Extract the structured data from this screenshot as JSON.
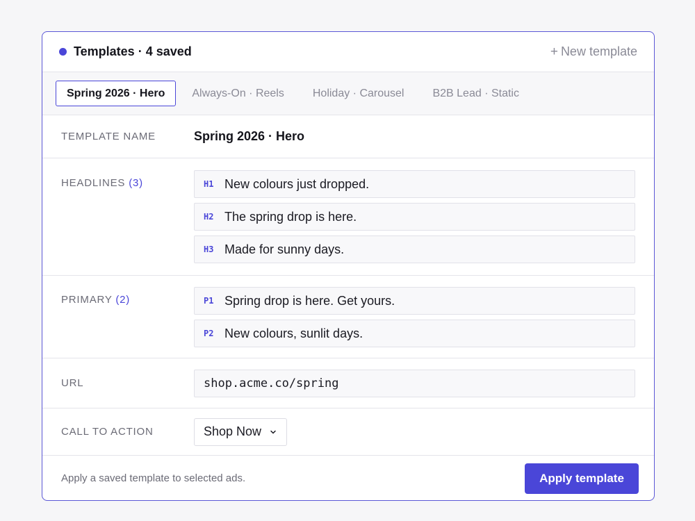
{
  "header": {
    "title": "Templates · 4 saved",
    "new_template_label": "New template",
    "new_template_icon": "+"
  },
  "tabs": [
    {
      "label": "Spring 2026 · Hero",
      "active": true
    },
    {
      "label": "Always-On · Reels",
      "active": false
    },
    {
      "label": "Holiday · Carousel",
      "active": false
    },
    {
      "label": "B2B Lead · Static",
      "active": false
    }
  ],
  "template_name": {
    "label": "TEMPLATE NAME",
    "value": "Spring 2026 · Hero"
  },
  "headlines": {
    "label": "HEADLINES",
    "count": "(3)",
    "items": [
      {
        "tag": "H1",
        "text": "New colours just dropped."
      },
      {
        "tag": "H2",
        "text": "The spring drop is here."
      },
      {
        "tag": "H3",
        "text": "Made for sunny days."
      }
    ]
  },
  "primary": {
    "label": "PRIMARY",
    "count": "(2)",
    "items": [
      {
        "tag": "P1",
        "text": "Spring drop is here. Get yours."
      },
      {
        "tag": "P2",
        "text": "New colours, sunlit days."
      }
    ]
  },
  "url": {
    "label": "URL",
    "value": "shop.acme.co/spring"
  },
  "cta": {
    "label": "CALL TO ACTION",
    "value": "Shop Now"
  },
  "footer": {
    "note": "Apply a saved template to selected ads.",
    "apply_label": "Apply template"
  },
  "colors": {
    "accent": "#4a46d8",
    "border": "#e4e4ea",
    "muted_text": "#8a8a96"
  }
}
